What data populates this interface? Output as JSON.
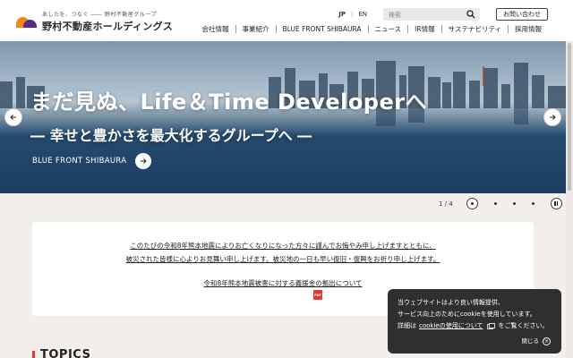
{
  "header": {
    "tagline": "あしたを、つなぐ ―― 野村不動産グループ",
    "brand": "野村不動産ホールディングス",
    "lang_jp": "JP",
    "lang_sep": "|",
    "lang_en": "EN",
    "search_placeholder": "検索",
    "contact_label": "お問い合わせ",
    "nav": [
      "会社情報",
      "事業紹介",
      "BLUE FRONT SHIBAURA",
      "ニュース",
      "IR情報",
      "サステナビリティ",
      "採用情報"
    ]
  },
  "hero": {
    "title": "まだ見ぬ、Life＆Time Developerへ",
    "subtitle": "― 幸せと豊かさを最大化するグループへ ―",
    "link_label": "BLUE FRONT SHIBAURA"
  },
  "slider": {
    "counter": "1 / 4"
  },
  "notice": {
    "line1": "このたびの令和8年熊本地震によりお亡くなりになった方々に謹んでお悔やみ申し上げますとともに、",
    "line2": "被災された皆様に心よりお見舞い申し上げます。被災地の一日も早い復旧・復興をお祈り申し上げます。",
    "link": "令和8年熊本地震被害に対する義援金の拠出について",
    "pdf_label": "PDF"
  },
  "topics": {
    "title": "TOPICS"
  },
  "cookie": {
    "line1": "当ウェブサイトはより良い情報提供、",
    "line2": "サービス向上のためにcookieを使用しています。",
    "line3_pre": "詳細は",
    "line3_link": "cookieの使用について",
    "line3_post": "をご覧ください。",
    "close_label": "閉じる"
  },
  "colors": {
    "accent_red": "#e0382d",
    "logo_orange": "#f08a1c",
    "logo_purple": "#5b2a86",
    "cookie_bg": "#2f2f2f"
  }
}
